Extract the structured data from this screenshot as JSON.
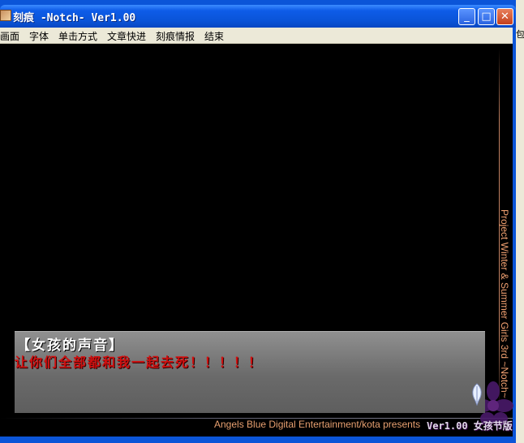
{
  "window": {
    "title": "刻痕 -Notch- Ver1.00",
    "controls": [
      "_",
      "□",
      "✕"
    ]
  },
  "menu": {
    "items": [
      "画面",
      "字体",
      "单击方式",
      "文章快进",
      "刻痕情报",
      "结束"
    ]
  },
  "dialog": {
    "speaker": "【女孩的声音】",
    "text": "让你们全部都和我一起去死！！！！！"
  },
  "footer": {
    "credit": "Angels Blue Digital Entertainment/kota presents",
    "version": "Ver1.00 女孩节版"
  },
  "side_credit": "Project Winter & Summer Girls 3rd ~Notch~",
  "peek_text": "包",
  "colors": {
    "titlebar": "#0A54D8",
    "stage": "#000000",
    "dialog_text": "#D01010",
    "credit": "#E8A070"
  }
}
